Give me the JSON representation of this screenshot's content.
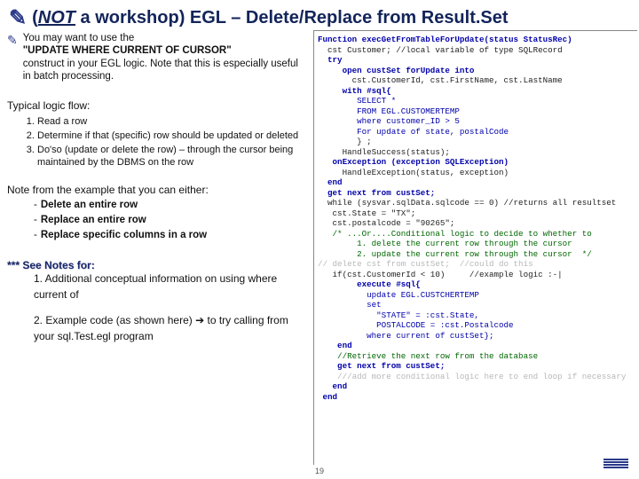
{
  "title": {
    "squiggle": "✎",
    "open_paren": "(",
    "not": "NOT",
    "rest": " a workshop) EGL – Delete/Replace from Result.Set"
  },
  "intro": {
    "lead": "You may want to use the",
    "quote": "\"UPDATE WHERE CURRENT OF CURSOR\"",
    "tail": "construct in your EGL logic.  Note that this is especially useful in batch processing."
  },
  "typical_heading": "Typical logic flow:",
  "steps": [
    "Read a row",
    "Determine if that (specific) row should be updated or deleted",
    "Do'so (update or delete the row) – through the cursor being maintained by the DBMS on the row"
  ],
  "note_heading": "Note from the example that you can either:",
  "note_items": [
    "Delete an entire row",
    "Replace an entire row",
    "Replace specific columns in a row"
  ],
  "see_notes": {
    "header": "*** See Notes for:",
    "items": [
      "1. Additional conceptual information on using where current of",
      "2. Example code (as shown here) ➔ to try calling from your sql.Test.egl program"
    ]
  },
  "code_lines": [
    {
      "t": "Function execGetFromTableForUpdate(status StatusRec)",
      "cls": "kw"
    },
    {
      "t": "  cst Customer; //local variable of type SQLRecord",
      "cls": ""
    },
    {
      "t": "  try",
      "cls": "kw"
    },
    {
      "t": "     open custSet forUpdate into",
      "cls": "kw"
    },
    {
      "t": "       cst.CustomerId, cst.FirstName, cst.LastName",
      "cls": ""
    },
    {
      "t": "     with #sql{",
      "cls": "kw"
    },
    {
      "t": "        SELECT *",
      "cls": "str"
    },
    {
      "t": "        FROM EGL.CUSTOMERTEMP",
      "cls": "str"
    },
    {
      "t": "        where customer_ID > 5",
      "cls": "str"
    },
    {
      "t": "        For update of state, postalCode",
      "cls": "str"
    },
    {
      "t": "        } ;",
      "cls": ""
    },
    {
      "t": "     HandleSuccess(status);",
      "cls": ""
    },
    {
      "t": "   onException (exception SQLException)",
      "cls": "kw"
    },
    {
      "t": "     HandleException(status, exception)",
      "cls": ""
    },
    {
      "t": "  end",
      "cls": "kw"
    },
    {
      "t": "",
      "cls": ""
    },
    {
      "t": "  get next from custSet;",
      "cls": "kw"
    },
    {
      "t": "  while (sysvar.sqlData.sqlcode == 0) //returns all resultset",
      "cls": ""
    },
    {
      "t": "   cst.State = \"TX\";",
      "cls": ""
    },
    {
      "t": "   cst.postalcode = \"90265\";",
      "cls": ""
    },
    {
      "t": "   /* ...Or....Conditional logic to decide to whether to",
      "cls": "cm"
    },
    {
      "t": "        1. delete the current row through the cursor",
      "cls": "cm"
    },
    {
      "t": "        2. update the current row through the cursor  */",
      "cls": "cm"
    },
    {
      "t": "// delete cst from custSet;  //could do this",
      "cls": "pale"
    },
    {
      "t": "   if(cst.CustomerId < 10)     //example logic :-|",
      "cls": ""
    },
    {
      "t": "        execute #sql{",
      "cls": "kw"
    },
    {
      "t": "          update EGL.CUSTCHERTEMP",
      "cls": "str"
    },
    {
      "t": "          set",
      "cls": "str"
    },
    {
      "t": "            \"STATE\" = :cst.State,",
      "cls": "str"
    },
    {
      "t": "            POSTALCODE = :cst.Postalcode",
      "cls": "str"
    },
    {
      "t": "          where current of custSet};",
      "cls": "str"
    },
    {
      "t": "    end",
      "cls": "kw"
    },
    {
      "t": "    //Retrieve the next row from the database",
      "cls": "cm"
    },
    {
      "t": "    get next from custSet;",
      "cls": "kw"
    },
    {
      "t": "    ///add more conditional logic here to end loop if necessary",
      "cls": "pale"
    },
    {
      "t": "   end",
      "cls": "kw"
    },
    {
      "t": " end",
      "cls": "kw"
    }
  ],
  "pagenum": "19"
}
